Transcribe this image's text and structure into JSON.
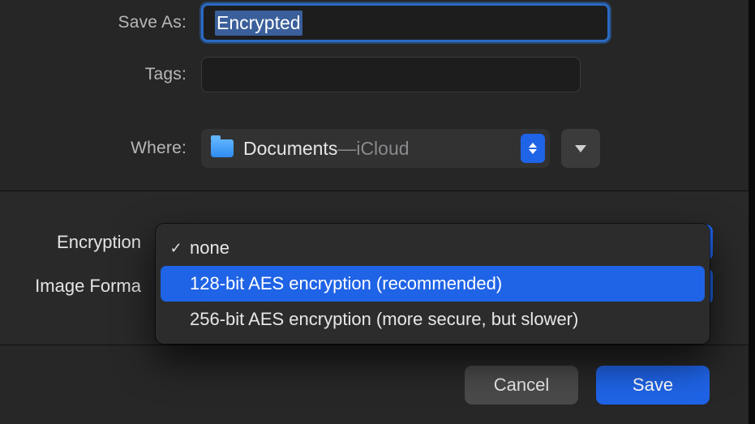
{
  "labels": {
    "save_as": "Save As:",
    "tags": "Tags:",
    "where": "Where:",
    "encryption": "Encryption",
    "image_format": "Image Forma"
  },
  "save_as_value": "Encrypted",
  "tags_value": "",
  "where": {
    "folder": "Documents",
    "separator": " — ",
    "location": "iCloud"
  },
  "encryption_menu": {
    "selected_index": 0,
    "highlight_index": 1,
    "options": [
      "none",
      "128-bit AES encryption (recommended)",
      "256-bit AES encryption (more secure, but slower)"
    ]
  },
  "buttons": {
    "cancel": "Cancel",
    "save": "Save"
  }
}
